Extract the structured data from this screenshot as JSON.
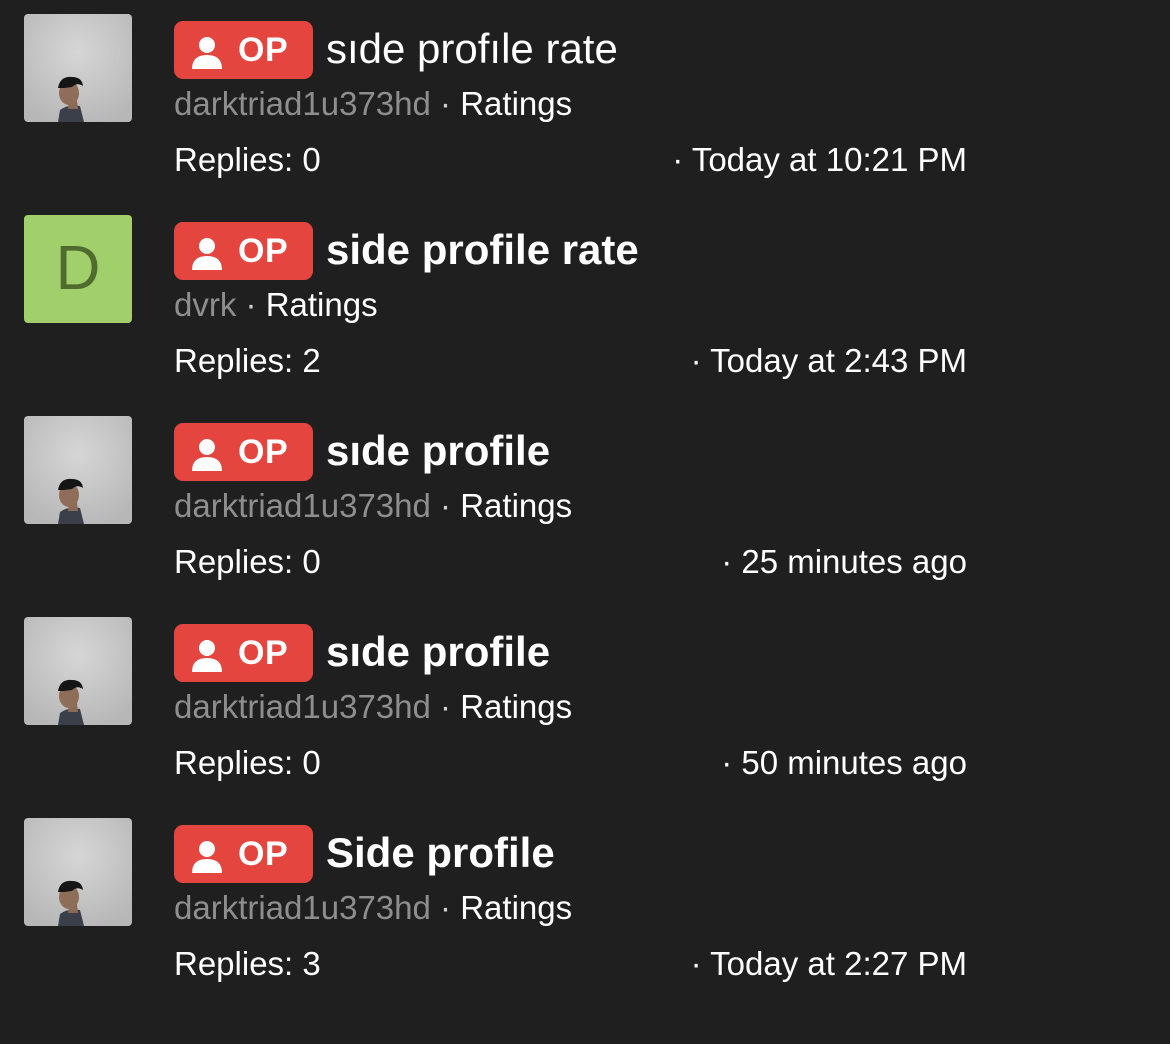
{
  "badge_label": "OP",
  "separator": "·",
  "replies_prefix": "Replies: ",
  "colors": {
    "background": "#1f1f1f",
    "badge": "#e4453f",
    "author": "#8e8e8e",
    "letter_avatar_bg": "#a1cf6b"
  },
  "threads": [
    {
      "avatar": {
        "type": "photo",
        "icon": "profile-photo"
      },
      "title": "sıde profıle rate",
      "title_bold": false,
      "author": "darktriad1u373hd",
      "forum": "Ratings",
      "replies": "Replies: 0",
      "time": "· Today at 10:21 PM"
    },
    {
      "avatar": {
        "type": "letter",
        "letter": "D"
      },
      "title": "side profile rate",
      "title_bold": true,
      "author": "dvrk",
      "forum": "Ratings",
      "replies": "Replies: 2",
      "time": "· Today at 2:43 PM"
    },
    {
      "avatar": {
        "type": "photo",
        "icon": "profile-photo"
      },
      "title": "sıde profile",
      "title_bold": true,
      "author": "darktriad1u373hd",
      "forum": "Ratings",
      "replies": "Replies: 0",
      "time": "· 25 minutes ago"
    },
    {
      "avatar": {
        "type": "photo",
        "icon": "profile-photo"
      },
      "title": "sıde profile",
      "title_bold": true,
      "author": "darktriad1u373hd",
      "forum": "Ratings",
      "replies": "Replies: 0",
      "time": "· 50 minutes ago"
    },
    {
      "avatar": {
        "type": "photo",
        "icon": "profile-photo"
      },
      "title": "Side profile",
      "title_bold": true,
      "author": "darktriad1u373hd",
      "forum": "Ratings",
      "replies": "Replies: 3",
      "time": "· Today at 2:27 PM"
    }
  ]
}
